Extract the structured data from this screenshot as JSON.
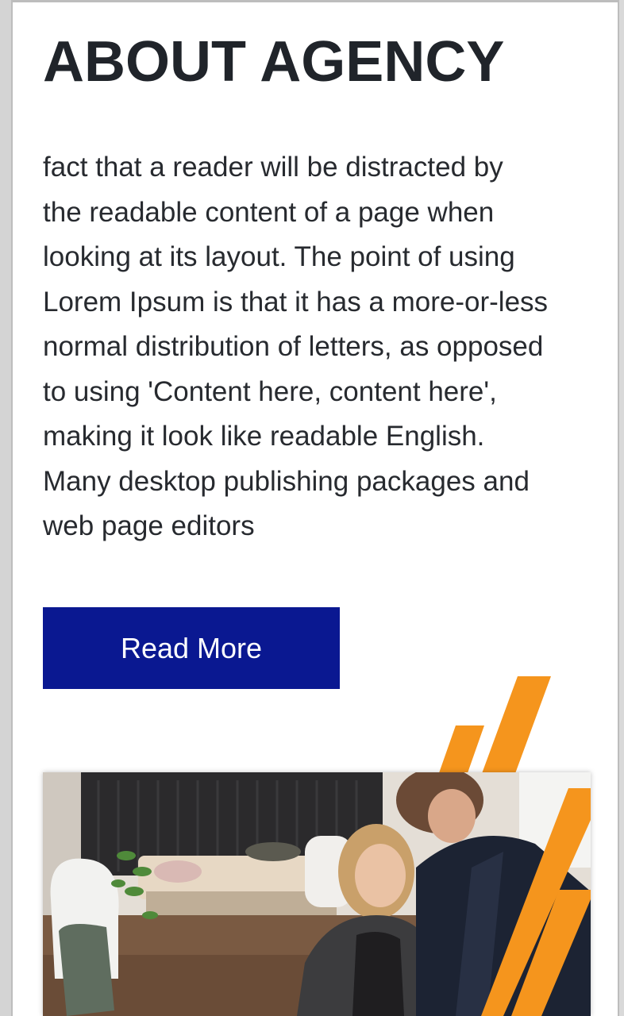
{
  "section": {
    "title": "ABOUT AGENCY",
    "paragraph_lines": [
      "fact that a reader will be distracted by",
      "the readable content of a page when",
      "looking at its layout. The point of using",
      "Lorem Ipsum is that it has a more-or-less",
      "normal distribution of letters, as opposed",
      "to using 'Content here, content here',",
      "making it look like readable English.",
      "Many desktop publishing packages and",
      "web page editors"
    ],
    "cta_label": "Read More"
  },
  "colors": {
    "button_bg": "#0a1891",
    "accent_orange": "#f5951d",
    "heading": "#20242a"
  },
  "image": {
    "description_icon": "office-photo"
  }
}
